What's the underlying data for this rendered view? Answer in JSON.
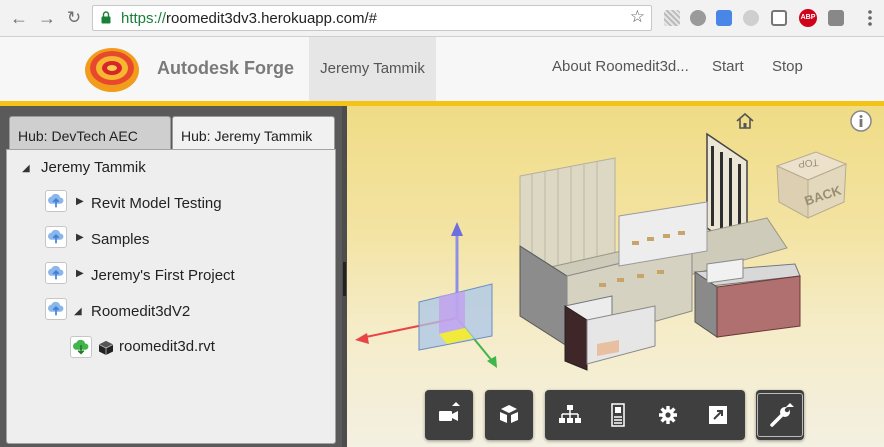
{
  "browser": {
    "url_scheme": "https://",
    "url_rest": "roomedit3dv3.herokuapp.com/#",
    "back_icon": "arrow-left-icon",
    "forward_icon": "arrow-right-icon",
    "reload_icon": "reload-icon",
    "bookmark_icon": "star-icon",
    "adblock_badge": "ABP"
  },
  "header": {
    "brand": "Autodesk Forge",
    "user": "Jeremy Tammik",
    "nav": [
      "About Roomedit3d...",
      "Start",
      "Stop"
    ],
    "accent_color": "#f4c316"
  },
  "hubs": {
    "tabs": [
      "Hub: DevTech AEC",
      "Hub: Jeremy Tammik"
    ],
    "active_tab": 1,
    "root": "Jeremy Tammik",
    "projects": [
      "Revit Model Testing",
      "Samples",
      "Jeremy's First Project",
      "Roomedit3dV2"
    ],
    "file": "roomedit3d.rvt"
  },
  "viewer": {
    "viewcube_top": "TOP",
    "viewcube_front": "BACK",
    "home_icon": "home-icon",
    "info_icon": "info-icon",
    "toolbar": [
      "camera-icon",
      "cube-icon",
      "model-tree-icon",
      "properties-icon",
      "settings-icon",
      "fullscreen-icon",
      "wrench-icon"
    ]
  }
}
